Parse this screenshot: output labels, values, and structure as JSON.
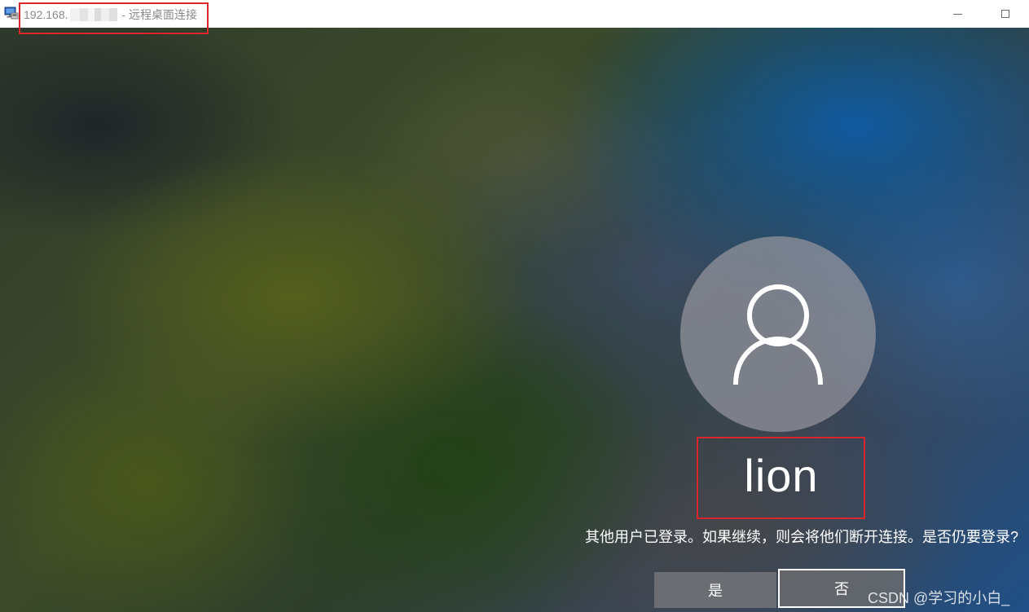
{
  "titlebar": {
    "ip_prefix": "192.168.",
    "ip_redacted_note": "",
    "separator": " - ",
    "app_title": "远程桌面连接",
    "minimize_label": "",
    "maximize_label": ""
  },
  "login": {
    "username": "lion",
    "prompt": "其他用户已登录。如果继续，则会将他们断开连接。是否仍要登录?",
    "yes_label": "是",
    "no_label": "否"
  },
  "watermark": {
    "text": "CSDN @学习的小白_"
  },
  "colors": {
    "highlight_border": "#d9262c",
    "titlebar_bg": "#ffffff",
    "title_text": "#8a8a8a",
    "button_text": "#ffffff"
  },
  "icons": {
    "app_icon": "remote-desktop-icon",
    "avatar_icon": "user-silhouette-icon",
    "minimize_icon": "minimize-icon",
    "maximize_icon": "maximize-icon"
  }
}
